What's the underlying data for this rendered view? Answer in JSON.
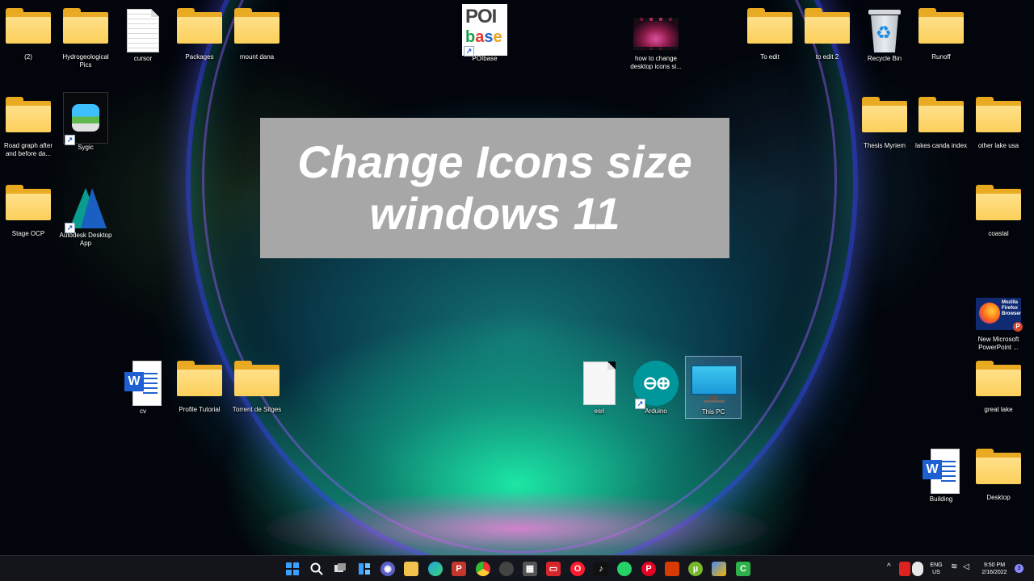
{
  "banner": {
    "line1": "Change Icons size",
    "line2": "windows 11"
  },
  "desktop_icons": {
    "folder_2": "(2)",
    "hydrogeological": "Hydrogeological Pics",
    "cursor": "cursor",
    "packages": "Packages",
    "mount_dana": "mount dana",
    "poibase": "POIbase",
    "poibase_logo_top": "POI",
    "poibase_logo_bottom": [
      "b",
      "a",
      "s",
      "e"
    ],
    "video": "how to change desktop icons si...",
    "to_edit": "To edit",
    "to_edit_2": "to edit 2",
    "recycle_bin": "Recycle Bin",
    "runoff": "Runoff",
    "road_graph": "Road graph after and before da...",
    "sygic": "Sygic",
    "thesis": "Thesis Myriem",
    "lakes": "lakes canda index",
    "other_lake": "other lake usa",
    "stage_ocp": "Stage OCP",
    "autodesk": "Autodesk Desktop App",
    "coastal": "coastal",
    "ppt": "New Microsoft PowerPoint ...",
    "ppt_thumb_text": "Mozilla Firefox Browser",
    "cv": "cv",
    "profile_tutorial": "Profile Tutorial",
    "torrent": "Torrent de Sitges",
    "esri": "esri",
    "arduino": "Arduino",
    "this_pc": "This PC",
    "great_lake": "great lake",
    "building": "Building",
    "desktop": "Desktop"
  },
  "taskbar": {
    "apps": [
      "start-icon",
      "search-icon",
      "task-view-icon",
      "widgets-icon",
      "teams-chat-icon",
      "file-explorer-icon",
      "edge-icon",
      "app-p-icon",
      "chrome-icon",
      "app-icon",
      "store-icon",
      "app-red-icon",
      "opera-icon",
      "tiktok-icon",
      "whatsapp-icon",
      "pinterest-icon",
      "office-icon",
      "utorrent-icon",
      "app-icon-2",
      "camtasia-icon"
    ],
    "lang_1": "ENG",
    "lang_2": "US",
    "time": "9:50 PM",
    "date": "2/16/2022",
    "notification_count": "3"
  },
  "colors": {
    "folder": "#fbcf5a",
    "banner": "#a7a7a7",
    "taskbar": "#14161c"
  }
}
